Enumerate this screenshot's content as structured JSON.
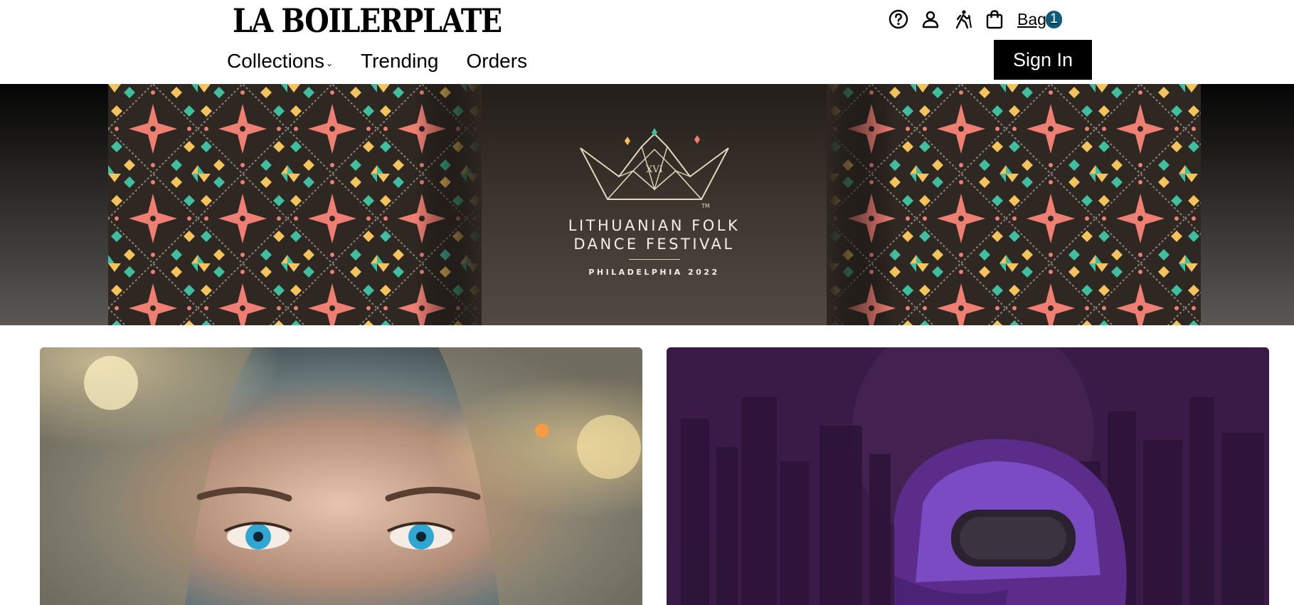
{
  "header": {
    "logo": "LA BOILERPLATE",
    "nav": [
      {
        "label": "Collections",
        "has_dropdown": true
      },
      {
        "label": "Trending"
      },
      {
        "label": "Orders"
      }
    ],
    "icons": [
      "help-icon",
      "user-icon",
      "hiker-icon",
      "shopping-bag-icon"
    ],
    "bag_label": "Bag",
    "bag_count": "1",
    "signin_label": "Sign In"
  },
  "banner": {
    "title_line1": "LITHUANIAN FOLK",
    "title_line2": "DANCE FESTIVAL",
    "subtitle": "PHILADELPHIA 2022",
    "crown_numeral": "XVI",
    "trademark": "TM",
    "pattern_colors": [
      "#3fbfa0",
      "#f4c35c",
      "#ef7f73",
      "#8d8379"
    ]
  },
  "colors": {
    "signin_bg": "#000000",
    "bag_badge": "#0f5a7a"
  }
}
